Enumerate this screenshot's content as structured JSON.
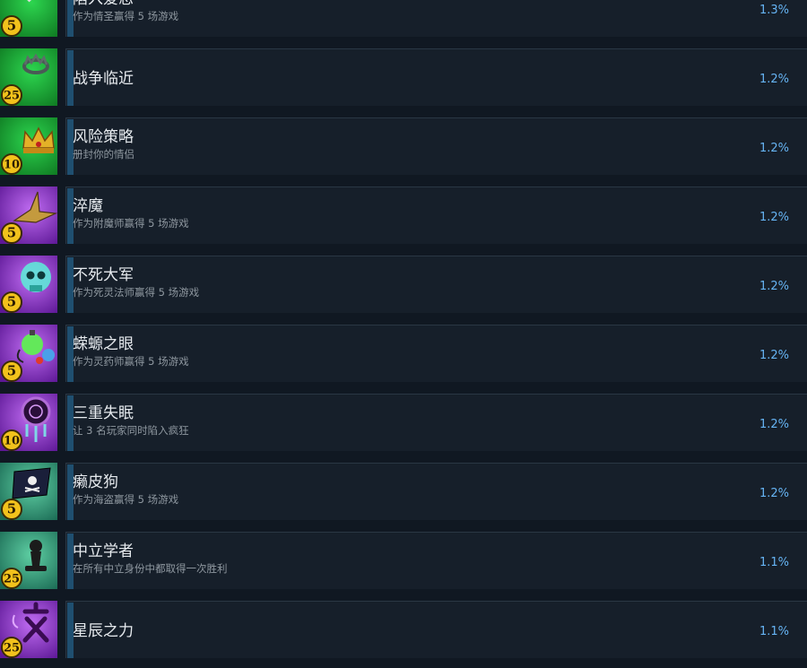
{
  "achievements": [
    {
      "title": "陷入爱恋",
      "desc": "作为情圣赢得 5 场游戏",
      "pct": "1.3%",
      "points": "5",
      "theme": "green",
      "icon": "sword-heart-icon"
    },
    {
      "title": "战争临近",
      "desc": "",
      "pct": "1.2%",
      "points": "25",
      "theme": "green",
      "icon": "crown-ring-icon"
    },
    {
      "title": "风险策略",
      "desc": "册封你的情侣",
      "pct": "1.2%",
      "points": "10",
      "theme": "green",
      "icon": "golden-crown-icon"
    },
    {
      "title": "淬魔",
      "desc": "作为附魔师赢得 5 场游戏",
      "pct": "1.2%",
      "points": "5",
      "theme": "purple",
      "icon": "paper-crane-icon"
    },
    {
      "title": "不死大军",
      "desc": "作为死灵法师赢得 5 场游戏",
      "pct": "1.2%",
      "points": "5",
      "theme": "purple",
      "icon": "glowing-skull-icon"
    },
    {
      "title": "蝾螈之眼",
      "desc": "作为灵药师赢得 5 场游戏",
      "pct": "1.2%",
      "points": "5",
      "theme": "purple",
      "icon": "potion-flask-icon"
    },
    {
      "title": "三重失眠",
      "desc": "让 3 名玩家同时陷入疯狂",
      "pct": "1.2%",
      "points": "10",
      "theme": "purple",
      "icon": "dreamcatcher-icon"
    },
    {
      "title": "癞皮狗",
      "desc": "作为海盗赢得 5 场游戏",
      "pct": "1.2%",
      "points": "5",
      "theme": "teal",
      "icon": "pirate-flag-icon"
    },
    {
      "title": "中立学者",
      "desc": "在所有中立身份中都取得一次胜利",
      "pct": "1.1%",
      "points": "25",
      "theme": "teal",
      "icon": "chess-pawn-icon"
    },
    {
      "title": "星辰之力",
      "desc": "",
      "pct": "1.1%",
      "points": "25",
      "theme": "purple",
      "icon": "star-glyph-icon"
    }
  ],
  "colors": {
    "green": [
      "#2dd64f",
      "#0f7a22"
    ],
    "purple": [
      "#c06cf2",
      "#5d1896"
    ],
    "teal": [
      "#5fd0a4",
      "#1b6b55"
    ],
    "coin": "#f2c21c",
    "percent": "#66b4f4"
  }
}
